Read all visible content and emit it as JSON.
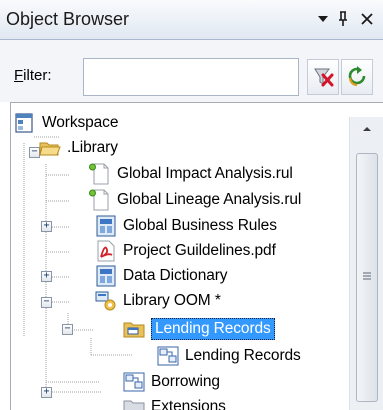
{
  "panel": {
    "title": "Object Browser"
  },
  "filter": {
    "label_prefix": "F",
    "label_rest": "ilter:",
    "value": "",
    "placeholder": ""
  },
  "tree": {
    "items": [
      {
        "label": "Workspace",
        "icon": "workspace-icon"
      },
      {
        "label": ".Library",
        "icon": "folder-open-icon"
      },
      {
        "label": "Global Impact Analysis.rul",
        "icon": "rule-document-icon"
      },
      {
        "label": "Global Lineage Analysis.rul",
        "icon": "rule-document-icon"
      },
      {
        "label": "Global Business Rules",
        "icon": "model-icon"
      },
      {
        "label": "Project Guildelines.pdf",
        "icon": "pdf-icon"
      },
      {
        "label": "Data Dictionary",
        "icon": "model-icon"
      },
      {
        "label": "Library OOM *",
        "icon": "oom-model-icon"
      },
      {
        "label": "Lending Records",
        "icon": "package-icon",
        "selected": true
      },
      {
        "label": "Lending Records",
        "icon": "class-diagram-icon"
      },
      {
        "label": "Borrowing",
        "icon": "class-diagram-icon"
      },
      {
        "label": "Extensions",
        "icon": "folder-icon"
      }
    ]
  },
  "colors": {
    "selection": "#3399ff",
    "titlebar": "#e1e8f2",
    "tree_line": "#a0a0a0"
  }
}
